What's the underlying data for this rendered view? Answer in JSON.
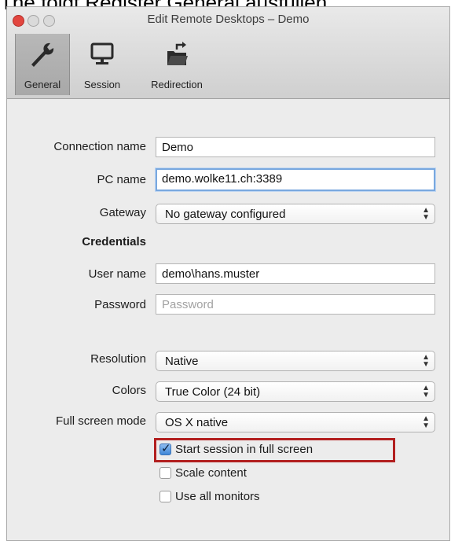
{
  "caption": "The folgt Register General ausfüllen.",
  "window": {
    "title": "Edit Remote Desktops – Demo"
  },
  "toolbar": [
    {
      "label": "General",
      "icon": "wrench-icon",
      "selected": true
    },
    {
      "label": "Session",
      "icon": "monitor-icon",
      "selected": false
    },
    {
      "label": "Redirection",
      "icon": "folder-redirect-icon",
      "selected": false
    }
  ],
  "form": {
    "connection_name": {
      "label": "Connection name",
      "value": "Demo"
    },
    "pc_name": {
      "label": "PC name",
      "value": "demo.wolke11.ch:3389"
    },
    "gateway": {
      "label": "Gateway",
      "value": "No gateway configured"
    },
    "credentials_heading": "Credentials",
    "user_name": {
      "label": "User name",
      "value": "demo\\hans.muster"
    },
    "password": {
      "label": "Password",
      "value": "",
      "placeholder": "Password"
    },
    "resolution": {
      "label": "Resolution",
      "value": "Native"
    },
    "colors": {
      "label": "Colors",
      "value": "True Color (24 bit)"
    },
    "full_screen_mode": {
      "label": "Full screen mode",
      "value": "OS X native"
    },
    "checkboxes": [
      {
        "label": "Start session in full screen",
        "checked": true
      },
      {
        "label": "Scale content",
        "checked": false
      },
      {
        "label": "Use all monitors",
        "checked": false
      }
    ]
  },
  "colors": {
    "highlight": "#b21f1f",
    "focus_ring": "#79a8df",
    "close_button": "#e2463f"
  }
}
